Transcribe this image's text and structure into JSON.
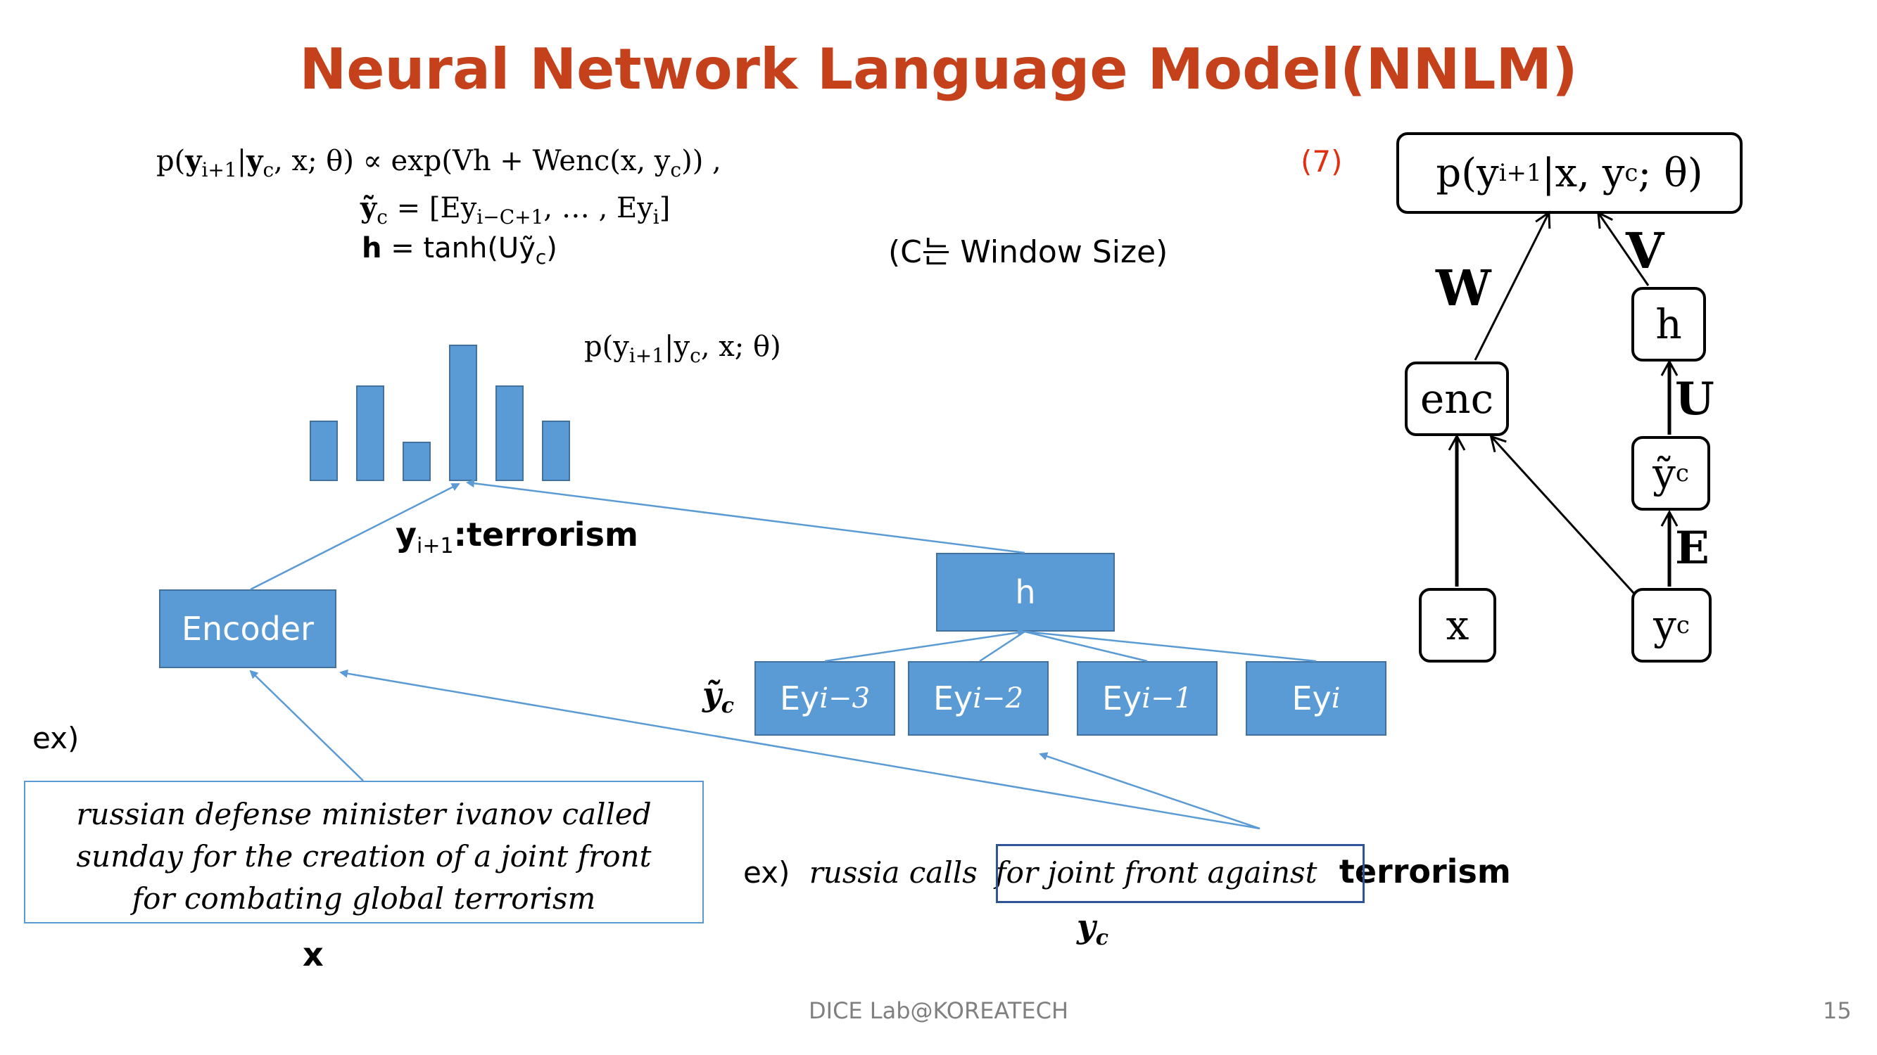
{
  "title": "Neural Network Language Model(NNLM)",
  "equations": {
    "eq1_lhs": "p(",
    "eq1_y": "y",
    "eq1_sub1": "i+1",
    "eq1_mid": "|",
    "eq1_yc": "y",
    "eq1_subc": "c",
    "eq1_rest": ", x; θ) ∝ exp(Vh + Wenc(x, y",
    "eq1_sub2": "c",
    "eq1_end": ")) ,",
    "eq2_lhs": "ỹ",
    "eq2_sub": "c",
    "eq2_rhs": " = [Ey",
    "eq2_sub2": "i−C+1",
    "eq2_mid": ",  … , Ey",
    "eq2_sub3": "i",
    "eq2_end": "]",
    "eq3_lhs": "h",
    "eq3_rhs": " =  tanh(Uỹ",
    "eq3_sub": "c",
    "eq3_end": ")",
    "eq_number": "(7)",
    "window_note": "(C는 Window Size)"
  },
  "dist_label": {
    "text": "p(y",
    "sub1": "i+1",
    "mid": "|y",
    "sub2": "c",
    "end": ", x; θ)"
  },
  "bars": [
    0.45,
    0.7,
    0.27,
    0.95,
    0.7,
    0.45
  ],
  "target_label": {
    "y": "y",
    "sub": "i+1",
    "word": ":terrorism"
  },
  "encoder_label": "Encoder",
  "h_label": "h",
  "ytilde_label": {
    "main": "ỹ",
    "sub": "c"
  },
  "context_boxes": [
    {
      "prefix": "Ey",
      "sub": "i−3"
    },
    {
      "prefix": "Ey",
      "sub": "i−2"
    },
    {
      "prefix": "Ey",
      "sub": "i−1"
    },
    {
      "prefix": "Ey",
      "sub": "i"
    }
  ],
  "example_label": "ex)",
  "example_x_lines": [
    "russian defense minister ivanov called",
    "sunday  for the creation of a joint front",
    "for combating global terrorism"
  ],
  "x_label": "x",
  "example_y": {
    "prefix": "ex)",
    "lead": "russia calls",
    "context": "for joint front against",
    "target": "terrorism",
    "label": "y",
    "label_sub": "c"
  },
  "graph": {
    "top_node": "p(y",
    "top_sub": "i+1",
    "top_rest": "|x, y",
    "top_sub2": "c",
    "top_end": "; θ)",
    "enc": "enc",
    "h": "h",
    "ytilde": "ỹ",
    "ytilde_sub": "c",
    "x": "x",
    "yc": "y",
    "yc_sub": "c",
    "W": "W",
    "V": "V",
    "U": "U",
    "E": "E"
  },
  "footer": "DICE Lab@KOREATECH",
  "page_number": "15",
  "colors": {
    "title": "#c5411b",
    "box_fill": "#5b9bd5",
    "box_border": "#41719c",
    "eq_number": "#e03010"
  }
}
